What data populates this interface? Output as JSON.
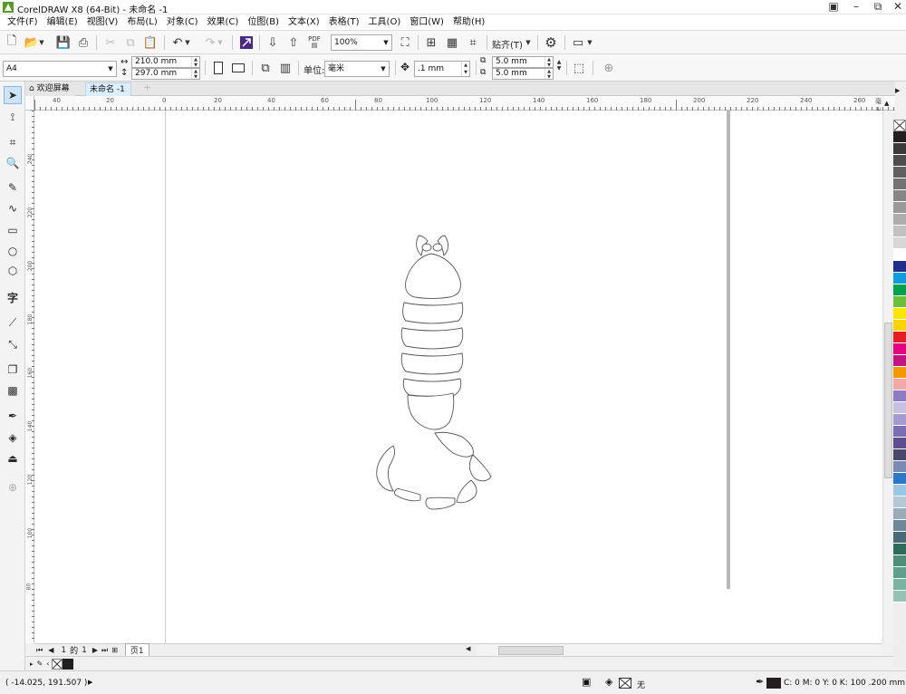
{
  "window": {
    "title": "CorelDRAW X8 (64-Bit) - 未命名 -1"
  },
  "menu": [
    "文件(F)",
    "编辑(E)",
    "视图(V)",
    "布局(L)",
    "对象(C)",
    "效果(C)",
    "位图(B)",
    "文本(X)",
    "表格(T)",
    "工具(O)",
    "窗口(W)",
    "帮助(H)"
  ],
  "standard_toolbar": {
    "zoom_value": "100%",
    "snap_label": "贴齐(T)",
    "pdf_label": "PDF"
  },
  "property_bar": {
    "page_size": "A4",
    "width": "210.0 mm",
    "height": "297.0 mm",
    "units_label": "单位:",
    "units_value": "毫米",
    "nudge": ".1 mm",
    "dup_x": "5.0 mm",
    "dup_y": "5.0 mm"
  },
  "tabs": {
    "welcome": "欢迎屏幕",
    "document": "未命名 -1"
  },
  "ruler": {
    "h_ticks": [
      "40",
      "20",
      "0",
      "20",
      "40",
      "60",
      "80",
      "100",
      "120",
      "140",
      "160",
      "180",
      "200",
      "220",
      "240",
      "260"
    ],
    "h_unit": "毫米",
    "v_ticks": [
      "260",
      "240",
      "220",
      "200",
      "180",
      "160",
      "140",
      "120",
      "100",
      "80",
      "60",
      "40"
    ]
  },
  "page_nav": {
    "current": "1",
    "of_label": "的",
    "total": "1",
    "page_tab": "页1"
  },
  "status": {
    "coords": "( -14.025, 191.507 )",
    "fill_none": "无",
    "outline_info": "C: 0 M: 0 Y: 0 K: 100  .200 mm"
  },
  "palette_colors": [
    "#231f20",
    "#3b3b3b",
    "#4d4d4d",
    "#606060",
    "#737373",
    "#868686",
    "#999999",
    "#adadad",
    "#c2c2c2",
    "#d7d7d7",
    "#ffffff",
    "#1e2f8c",
    "#0f9be0",
    "#00a14b",
    "#6cbf3b",
    "#ffe600",
    "#ffd200",
    "#e41e26",
    "#e4007f",
    "#c3157f",
    "#f39800",
    "#f4a9a8",
    "#8e7cc3",
    "#c7c0e0",
    "#a69bd1",
    "#7a6fb3",
    "#5d4f8f",
    "#4a4868",
    "#7b8ab5",
    "#2b78c8",
    "#9bc6e6",
    "#b4c7d6",
    "#9aabba",
    "#6f8899",
    "#4a6a7a",
    "#2f6b5c",
    "#4f8f7a",
    "#5fa08c",
    "#7ab3a0",
    "#96c2b5"
  ],
  "colors": {
    "accent": "#cde4f7",
    "canvas": "#ffffff",
    "chrome": "#f0f0f0"
  }
}
